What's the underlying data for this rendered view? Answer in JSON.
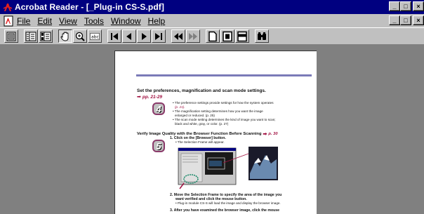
{
  "window": {
    "title": "Acrobat Reader - [_Plug-in CS-S.pdf]",
    "controls": {
      "minimize": "_",
      "restore": "□",
      "close": "×"
    }
  },
  "menu": {
    "items": [
      {
        "label": "File"
      },
      {
        "label": "Edit"
      },
      {
        "label": "View"
      },
      {
        "label": "Tools"
      },
      {
        "label": "Window"
      },
      {
        "label": "Help"
      }
    ]
  },
  "toolbar": {
    "buttons": [
      "page-only-icon",
      "bookmarks-and-page-icon",
      "thumbnails-and-page-icon",
      "hand-tool-icon",
      "zoom-tool-icon",
      "text-select-icon",
      "first-page-icon",
      "previous-page-icon",
      "next-page-icon",
      "last-page-icon",
      "go-back-icon",
      "go-forward-icon",
      "actual-size-icon",
      "fit-page-icon",
      "fit-width-icon",
      "find-icon"
    ]
  },
  "document": {
    "heading1": "Set the preferences, magnification and scan mode settings.",
    "ref1": "pp. 21-29",
    "step4_number": "4",
    "step4_bullets": [
      "• The preference settings provide settings for how the system operates",
      "(p. 21).",
      "• The magnification setting determines how you want the image",
      "enlarged or reduced. (p. 25)",
      "• The scan mode setting determines the kind of image you want to scan;",
      "black and white, gray, or color. (p. 27)"
    ],
    "heading2": "Verify Image Quality with the Browser Function Before Scanning",
    "ref2": "p. 30",
    "step5_number": "5",
    "step5_line1": "1.  Click on the [Browser] button.",
    "step5_line1_sub": "• The Selection Frame will appear.",
    "step5_line2": "2.  Move the Selection Frame to specify the area of the image you",
    "step5_line2b": "want verified and click the mouse button.",
    "step5_line2_sub": "• Plug-in module CS-S will load the image and display the browser image.",
    "step5_line3": "3.  After you have examined the browser image, click the mouse"
  }
}
